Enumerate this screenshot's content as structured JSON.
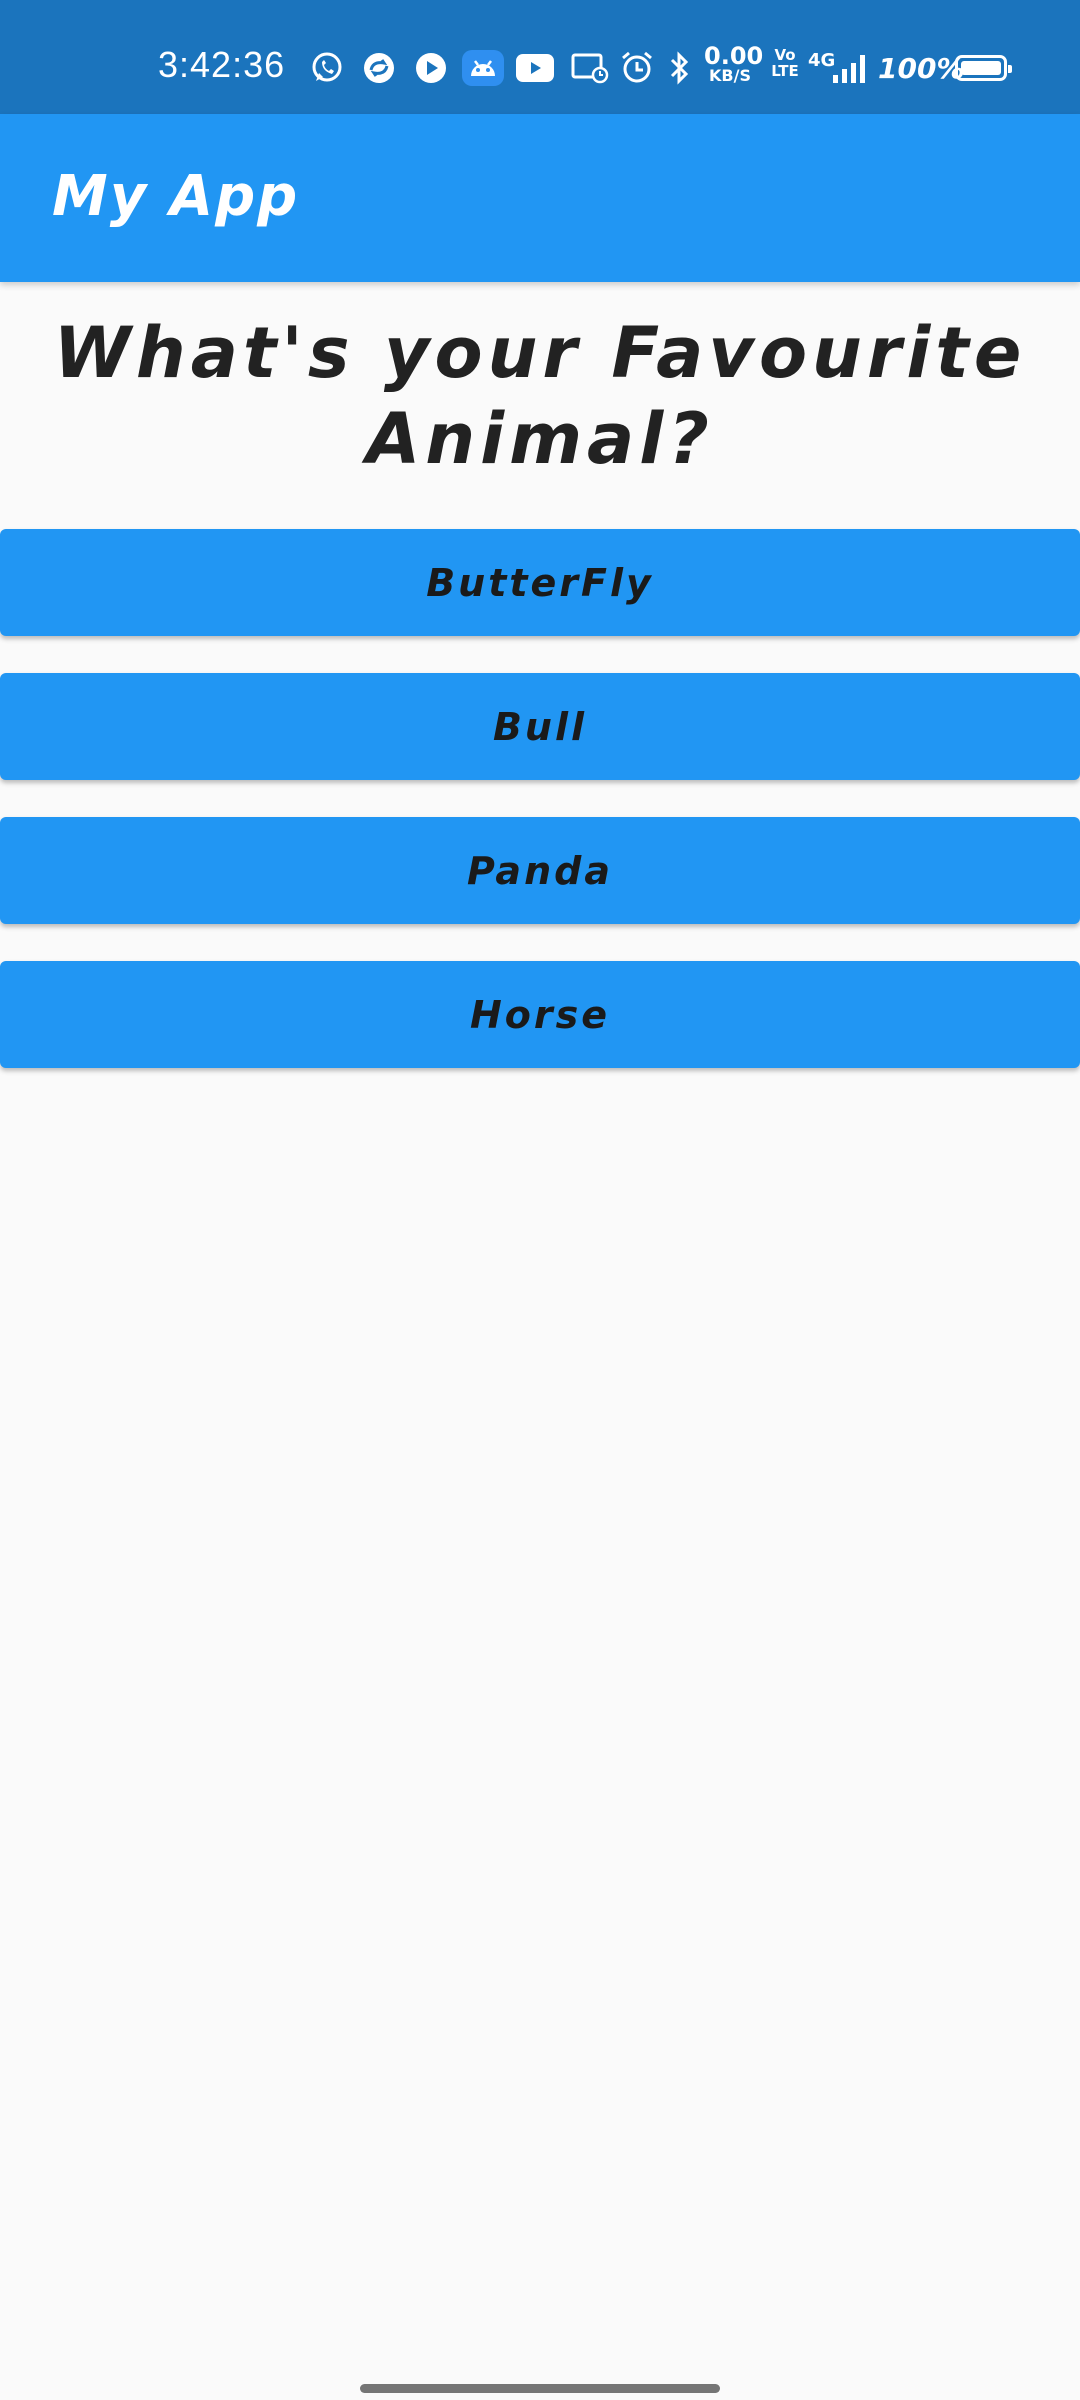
{
  "status_bar": {
    "time": "3:42:36",
    "net_speed_value": "0.00",
    "net_speed_unit": "KB/S",
    "volte_top": "Vo",
    "volte_bottom": "LTE",
    "network": "4G",
    "battery": "100%",
    "icons": [
      "whatsapp-icon",
      "sync-app-icon",
      "play-icon",
      "android-icon",
      "youtube-icon",
      "screen-record-icon",
      "alarm-icon",
      "bluetooth-icon",
      "signal-icon",
      "battery-icon"
    ]
  },
  "app_bar": {
    "title": "My App"
  },
  "question": {
    "line1": "What's your Favourite",
    "line2": "Animal?"
  },
  "options": [
    "ButterFly",
    "Bull",
    "Panda",
    "Horse"
  ],
  "colors": {
    "status_bar": "#1b74bd",
    "primary": "#2196f3",
    "background": "#fafafa"
  }
}
